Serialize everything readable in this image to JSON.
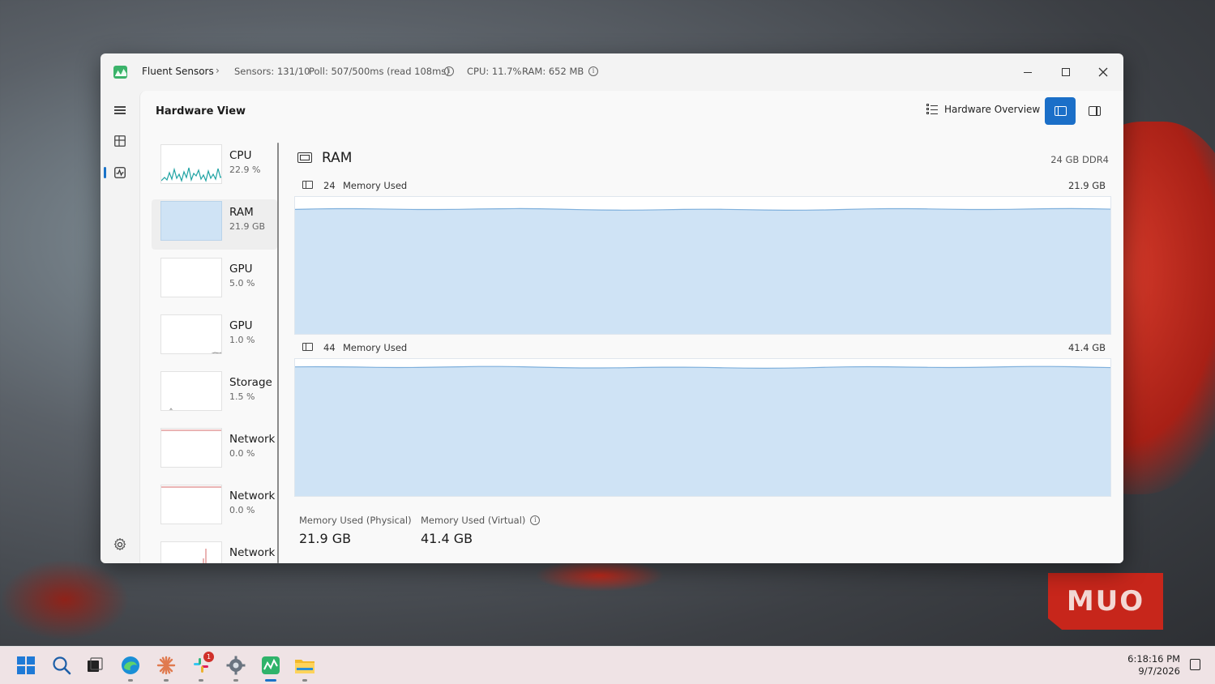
{
  "titlebar": {
    "app_name": "Fluent Sensors",
    "sensors": "Sensors: 131/10",
    "poll": "Poll: 507/500ms (read 108ms)",
    "cpu": "CPU: 11.7%",
    "ram": "RAM: 652 MB",
    "info_glyph": "i"
  },
  "rail": {
    "icons": [
      "hamburger-menu-icon",
      "dashboard-icon",
      "hardware-view-icon",
      "settings-icon"
    ]
  },
  "page": {
    "title": "Hardware View",
    "hardware_overview_label": "Hardware Overview"
  },
  "sensors": [
    {
      "name": "CPU",
      "value": "22.9 %"
    },
    {
      "name": "RAM",
      "value": "21.9 GB"
    },
    {
      "name": "GPU",
      "value": "5.0 %"
    },
    {
      "name": "GPU",
      "value": "1.0 %"
    },
    {
      "name": "Storage",
      "value": "1.5 %"
    },
    {
      "name": "Network",
      "value": "0.0 %"
    },
    {
      "name": "Network",
      "value": "0.0 %"
    },
    {
      "name": "Network",
      "value": ""
    }
  ],
  "detail": {
    "title": "RAM",
    "spec": "24 GB DDR4",
    "series": [
      {
        "count": "24",
        "label": "Memory Used",
        "value": "21.9 GB",
        "fill_fraction": 0.91
      },
      {
        "count": "44",
        "label": "Memory Used",
        "value": "41.4 GB",
        "fill_fraction": 0.94
      }
    ],
    "footer": [
      {
        "label": "Memory Used (Physical)",
        "value": "21.9 GB"
      },
      {
        "label": "Memory Used (Virtual)",
        "value": "41.4 GB"
      }
    ]
  },
  "colors": {
    "accent": "#1b6fc8",
    "chart_fill": "#cfe3f5",
    "chart_line": "#7fb0dc",
    "cpu_line": "#1fa3a3"
  },
  "taskbar": {
    "icons": [
      "start-icon",
      "search-icon",
      "task-view-icon",
      "edge-icon",
      "claude-icon",
      "slack-icon",
      "settings-icon",
      "fluent-sensors-icon",
      "file-explorer-icon"
    ],
    "slack_badge": "1",
    "time": "6:18:16 PM",
    "date": "9/7/2026"
  },
  "watermark": "MUO"
}
